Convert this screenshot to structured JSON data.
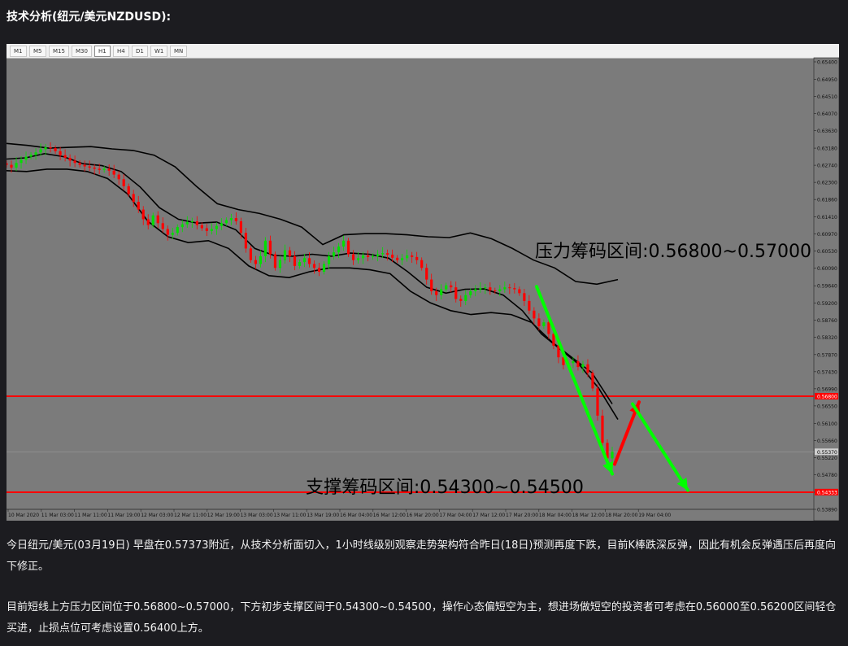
{
  "title": "技术分析(纽元/美元NZDUSD):",
  "timeframes": [
    "M1",
    "M5",
    "M15",
    "M30",
    "H1",
    "H4",
    "D1",
    "W1",
    "MN"
  ],
  "active_timeframe": "H1",
  "annotations": {
    "resistance": "压力筹码区间:0.56800~0.57000",
    "support": "支撑筹码区间:0.54300~0.54500"
  },
  "chart_data": {
    "type": "candlestick",
    "symbol": "NZDUSD",
    "ylim": [
      0.5389,
      0.654
    ],
    "y_ticks": [
      "0.65400",
      "0.64950",
      "0.64510",
      "0.64070",
      "0.63630",
      "0.63180",
      "0.62740",
      "0.62300",
      "0.61860",
      "0.61410",
      "0.60970",
      "0.60530",
      "0.60090",
      "0.59640",
      "0.59200",
      "0.58760",
      "0.58320",
      "0.57870",
      "0.57430",
      "0.56990",
      "0.56550",
      "0.56100",
      "0.55660",
      "0.55220",
      "0.54780",
      "0.54330",
      "0.53890"
    ],
    "x_ticks": [
      "10 Mar 2020",
      "11 Mar 03:00",
      "11 Mar 11:00",
      "11 Mar 19:00",
      "12 Mar 03:00",
      "12 Mar 11:00",
      "12 Mar 19:00",
      "13 Mar 03:00",
      "13 Mar 11:00",
      "13 Mar 19:00",
      "16 Mar 04:00",
      "16 Mar 12:00",
      "16 Mar 20:00",
      "17 Mar 04:00",
      "17 Mar 12:00",
      "17 Mar 20:00",
      "18 Mar 04:00",
      "18 Mar 12:00",
      "18 Mar 20:00",
      "19 Mar 04:00"
    ],
    "price_labels": {
      "resistance": "0.56800",
      "current": "0.55370",
      "support": "0.54333"
    },
    "horizontal_lines": [
      {
        "name": "resistance",
        "value": 0.568,
        "color": "#ff0000"
      },
      {
        "name": "support",
        "value": 0.5433,
        "color": "#ff0000"
      }
    ],
    "close_prices": [
      0.6275,
      0.6268,
      0.628,
      0.6288,
      0.6296,
      0.6301,
      0.6307,
      0.6315,
      0.632,
      0.6318,
      0.631,
      0.63,
      0.6293,
      0.6286,
      0.628,
      0.6275,
      0.6271,
      0.6268,
      0.6265,
      0.6262,
      0.6265,
      0.626,
      0.625,
      0.6238,
      0.622,
      0.62,
      0.618,
      0.616,
      0.6135,
      0.612,
      0.6145,
      0.6125,
      0.611,
      0.6095,
      0.61,
      0.6115,
      0.6122,
      0.6128,
      0.613,
      0.612,
      0.6112,
      0.6105,
      0.611,
      0.6118,
      0.6125,
      0.6133,
      0.6138,
      0.613,
      0.61,
      0.606,
      0.603,
      0.602,
      0.604,
      0.608,
      0.6045,
      0.601,
      0.603,
      0.6055,
      0.604,
      0.6015,
      0.6025,
      0.6035,
      0.602,
      0.601,
      0.6,
      0.602,
      0.604,
      0.605,
      0.6065,
      0.608,
      0.6045,
      0.603,
      0.6035,
      0.6042,
      0.6038,
      0.604,
      0.6045,
      0.6048,
      0.6044,
      0.6036,
      0.603,
      0.6035,
      0.6042,
      0.6038,
      0.603,
      0.601,
      0.598,
      0.595,
      0.594,
      0.5955,
      0.5965,
      0.596,
      0.593,
      0.5925,
      0.594,
      0.595,
      0.5955,
      0.5958,
      0.596,
      0.5952,
      0.595,
      0.5955,
      0.596,
      0.5958,
      0.5955,
      0.5945,
      0.5925,
      0.59,
      0.588,
      0.586,
      0.587,
      0.584,
      0.581,
      0.578,
      0.576,
      0.5765,
      0.577,
      0.5755,
      0.5762,
      0.574,
      0.57,
      0.563,
      0.556,
      0.552,
      0.5537
    ],
    "bollinger_bands": {
      "period_note": "",
      "middle": [
        0.629,
        0.6293,
        0.6304,
        0.6296,
        0.6278,
        0.6273,
        0.6258,
        0.6218,
        0.6165,
        0.6135,
        0.6125,
        0.6128,
        0.6108,
        0.606,
        0.6042,
        0.604,
        0.6045,
        0.604,
        0.6048,
        0.6045,
        0.6035,
        0.6,
        0.596,
        0.5945,
        0.5955,
        0.5956,
        0.594,
        0.59,
        0.584,
        0.58,
        0.576,
        0.57,
        0.562
      ],
      "upper": [
        0.633,
        0.6325,
        0.6318,
        0.632,
        0.6322,
        0.6316,
        0.6312,
        0.63,
        0.627,
        0.622,
        0.6175,
        0.616,
        0.615,
        0.6135,
        0.6115,
        0.607,
        0.6095,
        0.6098,
        0.6098,
        0.6095,
        0.609,
        0.6088,
        0.61,
        0.6085,
        0.606,
        0.603,
        0.601,
        0.5975,
        0.5968,
        0.598
      ],
      "lower": [
        0.626,
        0.6258,
        0.6264,
        0.6264,
        0.6258,
        0.624,
        0.62,
        0.613,
        0.609,
        0.6075,
        0.608,
        0.606,
        0.6015,
        0.599,
        0.5985,
        0.6,
        0.601,
        0.601,
        0.6005,
        0.5995,
        0.595,
        0.592,
        0.59,
        0.589,
        0.5895,
        0.589,
        0.587,
        0.582,
        0.578,
        0.574,
        0.566
      ]
    },
    "arrows": [
      {
        "color": "#00ff00",
        "from": [
          "18 Mar 03:00",
          0.5962
        ],
        "to": [
          "18 Mar 23:00",
          0.548
        ]
      },
      {
        "color": "#ff0000",
        "from": [
          "19 Mar 00:00",
          0.5505
        ],
        "to": [
          "19 Mar 01:00",
          0.5665
        ]
      },
      {
        "color": "#00ff00",
        "from": [
          "19 Mar 02:00",
          0.566
        ],
        "to": [
          "19 Mar 05:00",
          0.5438
        ]
      }
    ],
    "colors": {
      "bull": "#00e000",
      "bear": "#ff0000",
      "background": "#7b7b7b",
      "band": "#000000"
    }
  },
  "paragraphs": [
    "今日纽元/美元(03月19日) 早盘在0.57373附近，从技术分析面切入，1小时线级别观察走势架构符合昨日(18日)预测再度下跌，目前K棒跌深反弹，因此有机会反弹遇压后再度向下修正。",
    "目前短线上方压力区间位于0.56800~0.57000，下方初步支撑区间于0.54300~0.54500，操作心态偏短空为主，想进场做短空的投资者可考虑在0.56000至0.56200区间轻仓买进，止损点位可考虑设置0.56400上方。"
  ]
}
